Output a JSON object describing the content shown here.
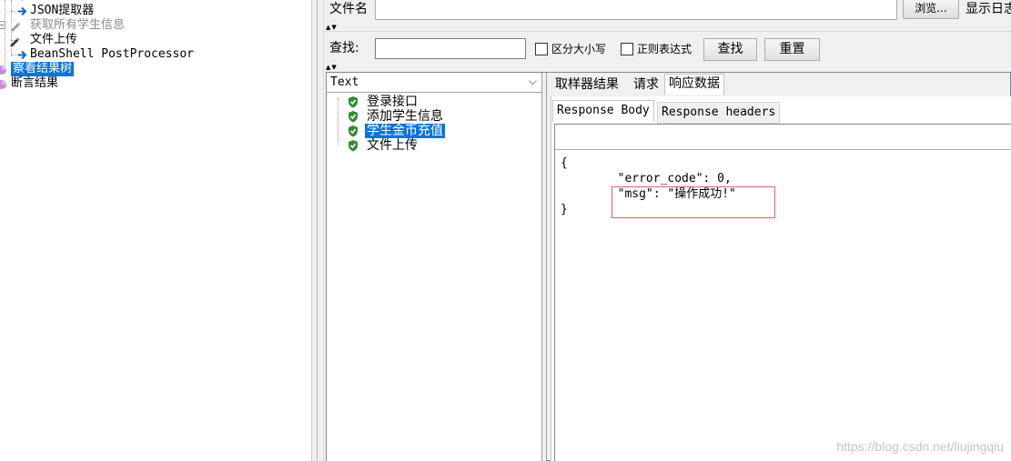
{
  "tree": {
    "items": [
      {
        "label": "JSON提取器",
        "icon": "arrow-icon",
        "disabled": false,
        "selected": false
      },
      {
        "label": "获取所有学生信息",
        "icon": "pencil-icon",
        "disabled": true,
        "selected": false
      },
      {
        "label": "文件上传",
        "icon": "pencil-icon",
        "disabled": false,
        "selected": false
      },
      {
        "label": "BeanShell PostProcessor",
        "icon": "arrow-icon",
        "disabled": false,
        "selected": false
      },
      {
        "label": "察看结果树",
        "icon": "chart-icon",
        "disabled": false,
        "selected": true
      },
      {
        "label": "断言结果",
        "icon": "chart-icon",
        "disabled": false,
        "selected": false
      }
    ]
  },
  "file_row": {
    "label": "文件名",
    "browse_label": "浏览...",
    "log_label": "显示日志"
  },
  "search_row": {
    "label": "查找:",
    "case_label": "区分大小写",
    "regex_label": "正则表达式",
    "find_label": "查找",
    "reset_label": "重置"
  },
  "renderer": {
    "selected": "Text"
  },
  "samples": [
    {
      "label": "登录接口",
      "status": "success",
      "selected": false
    },
    {
      "label": "添加学生信息",
      "status": "success",
      "selected": false
    },
    {
      "label": "学生金币充值",
      "status": "success",
      "selected": true
    },
    {
      "label": "文件上传",
      "status": "success",
      "selected": false
    }
  ],
  "tabs": {
    "sampler_result": "取样器结果",
    "request": "请求",
    "response_data": "响应数据"
  },
  "subtabs": {
    "body": "Response Body",
    "headers": "Response headers"
  },
  "response_body": {
    "line1": "{",
    "line2": "        \"error_code\": 0,",
    "line3": "        \"msg\": \"操作成功!\"",
    "line4": "}"
  },
  "watermark": "https://blog.csdn.net/liujingqiu",
  "colors": {
    "selection": "#0a74d8",
    "highlight_border": "#e06060",
    "success_shield": "#2e8b2e"
  }
}
